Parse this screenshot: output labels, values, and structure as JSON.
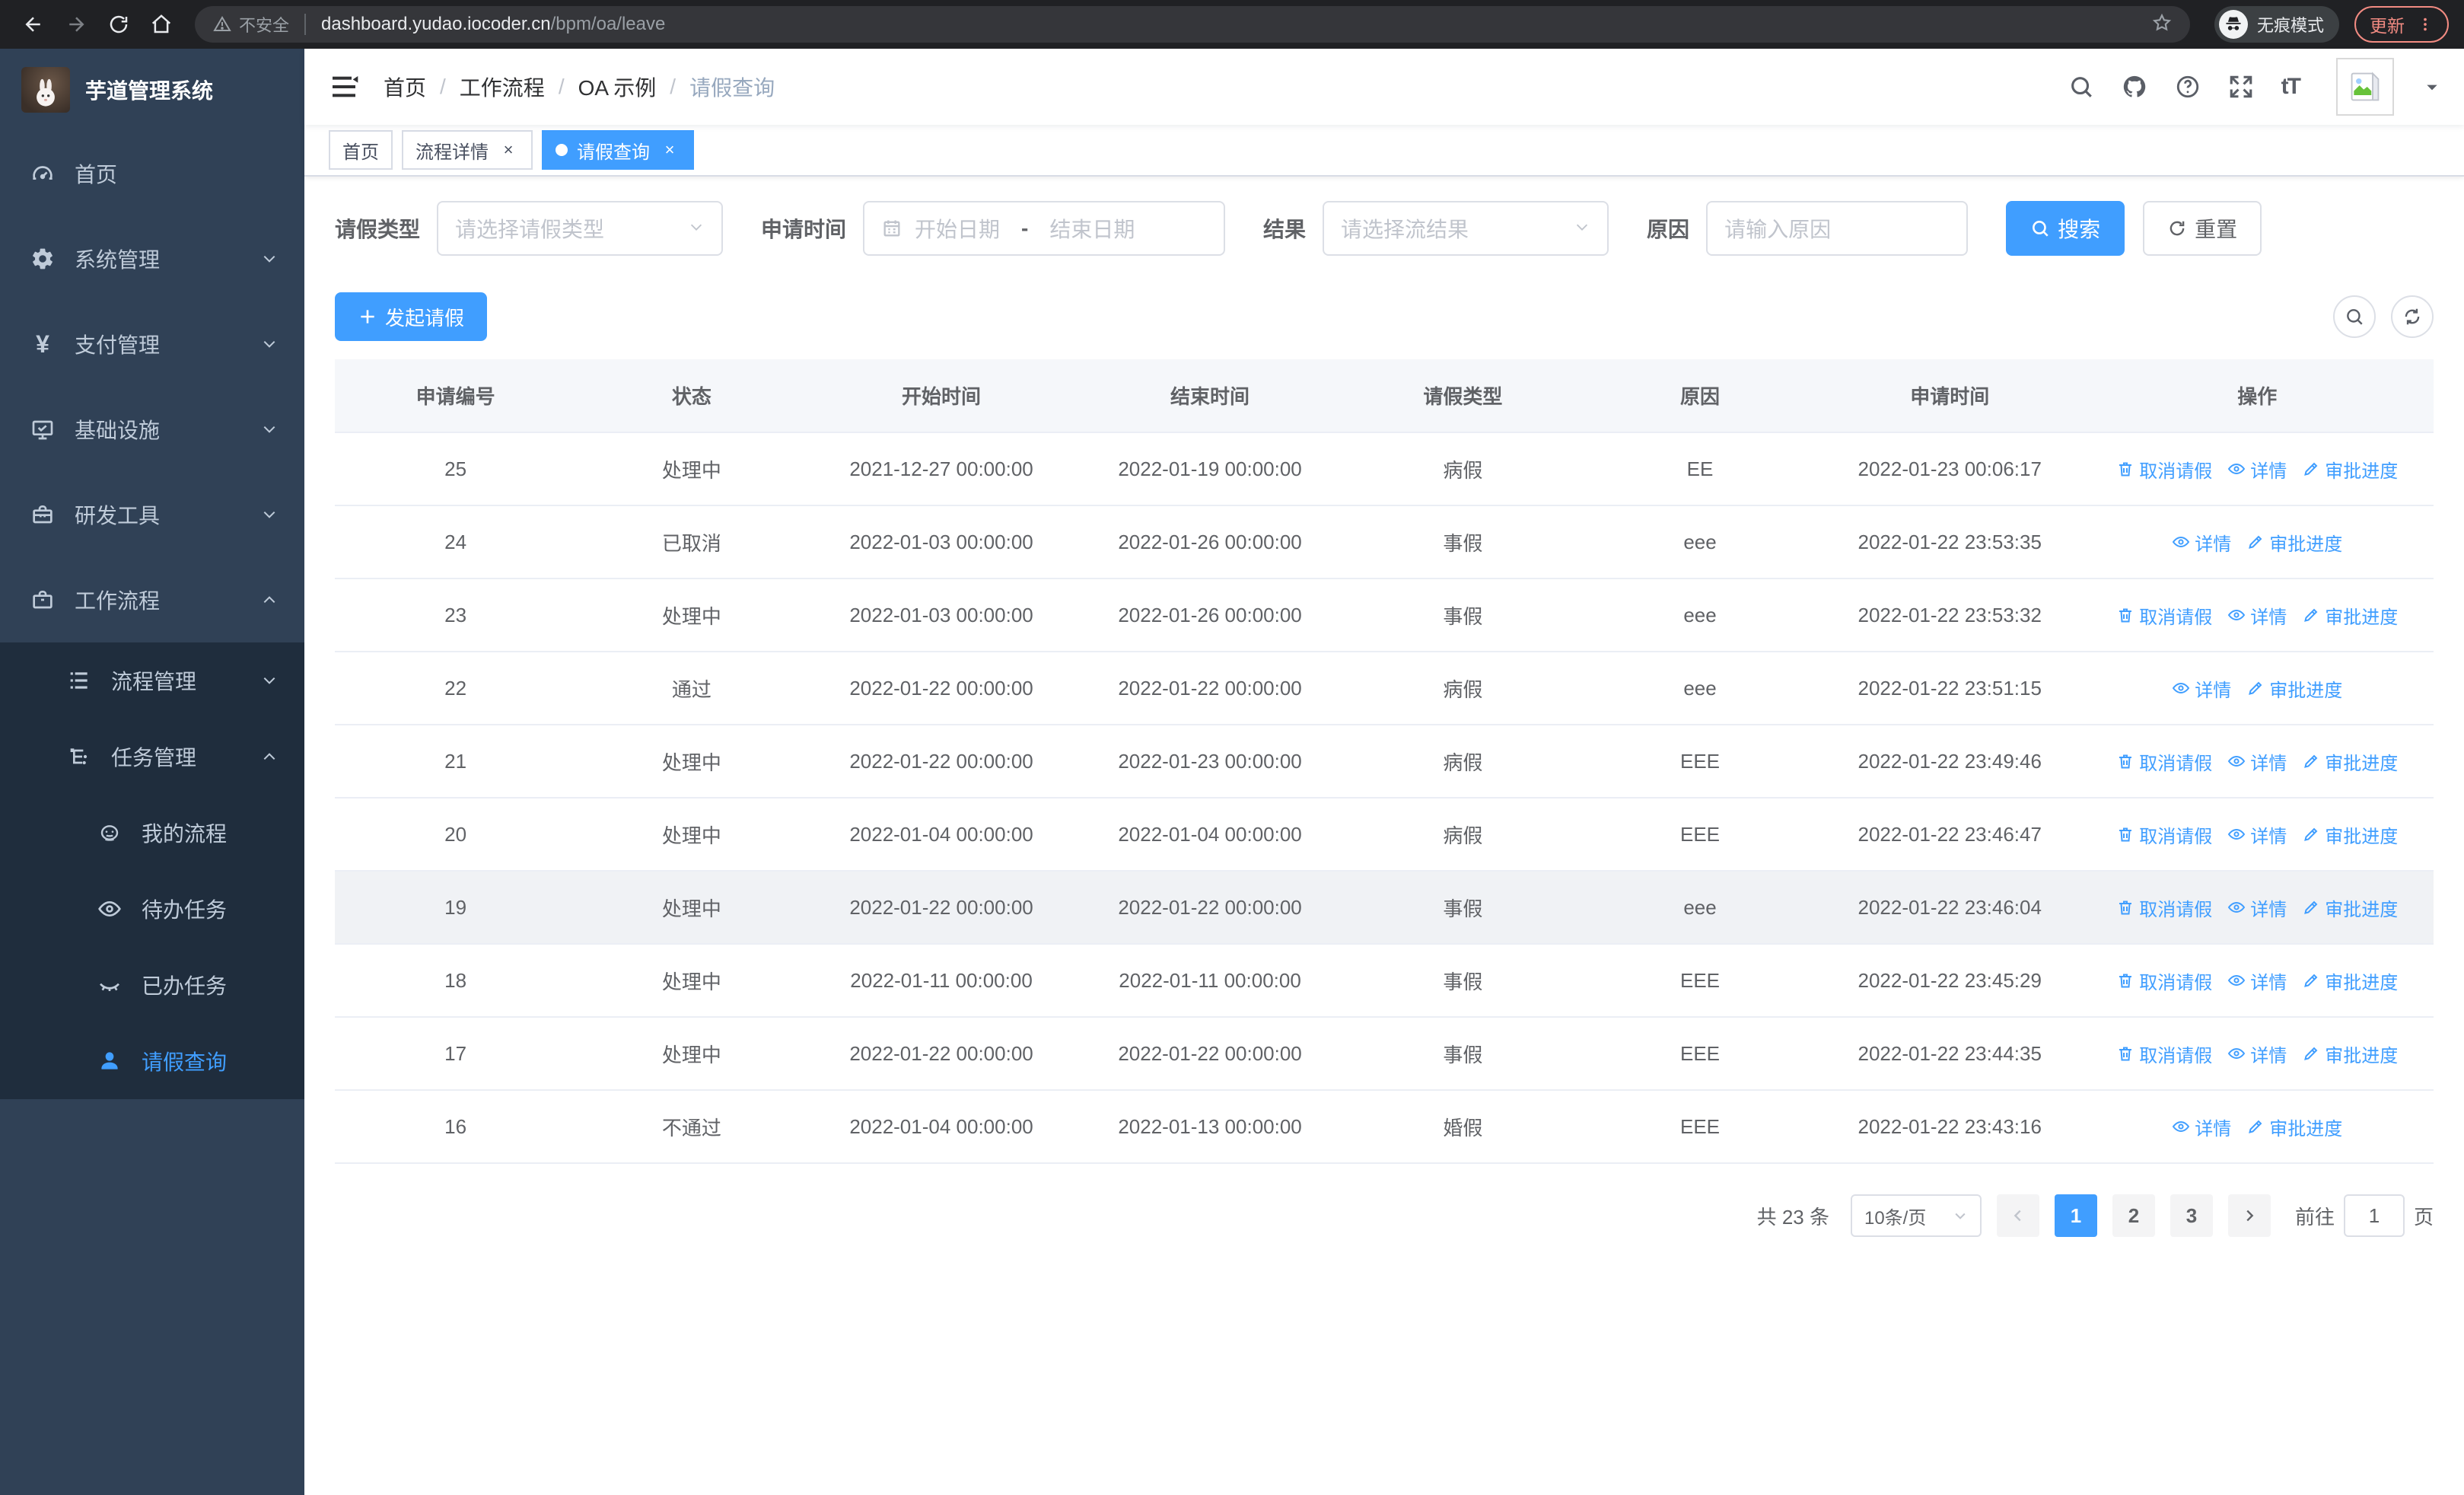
{
  "colors": {
    "accent": "#409EFF",
    "sidebar_bg": "#304156",
    "submenu_bg": "#1f2d3d",
    "update_badge": "#f28b82"
  },
  "browser": {
    "security_label": "不安全",
    "url_host": "dashboard.yudao.iocoder.cn",
    "url_path": "/bpm/oa/leave",
    "incognito_label": "无痕模式",
    "update_label": "更新"
  },
  "sidebar": {
    "title": "芋道管理系统",
    "items": [
      {
        "label": "首页",
        "icon": "gauge-icon",
        "level": 1
      },
      {
        "label": "系统管理",
        "icon": "gear-icon",
        "level": 1,
        "chevron": "down"
      },
      {
        "label": "支付管理",
        "icon": "yen-icon",
        "level": 1,
        "chevron": "down"
      },
      {
        "label": "基础设施",
        "icon": "monitor-icon",
        "level": 1,
        "chevron": "down"
      },
      {
        "label": "研发工具",
        "icon": "toolbox-icon",
        "level": 1,
        "chevron": "down"
      },
      {
        "label": "工作流程",
        "icon": "briefcase-icon",
        "level": 1,
        "chevron": "up"
      },
      {
        "label": "流程管理",
        "icon": "list-icon",
        "level": 2,
        "chevron": "down",
        "submenu": true
      },
      {
        "label": "任务管理",
        "icon": "flow-icon",
        "level": 2,
        "chevron": "up",
        "submenu": true
      },
      {
        "label": "我的流程",
        "icon": "robot-icon",
        "level": 3,
        "submenu": true
      },
      {
        "label": "待办任务",
        "icon": "eye-icon",
        "level": 3,
        "submenu": true
      },
      {
        "label": "已办任务",
        "icon": "eye-closed-icon",
        "level": 3,
        "submenu": true
      },
      {
        "label": "请假查询",
        "icon": "user-icon",
        "level": 3,
        "submenu": true,
        "active": true
      }
    ]
  },
  "navbar": {
    "breadcrumb": [
      "首页",
      "工作流程",
      "OA 示例",
      "请假查询"
    ]
  },
  "tags": [
    {
      "label": "首页",
      "closable": false,
      "active": false
    },
    {
      "label": "流程详情",
      "closable": true,
      "active": false
    },
    {
      "label": "请假查询",
      "closable": true,
      "active": true
    }
  ],
  "filters": {
    "leave_type_label": "请假类型",
    "leave_type_placeholder": "请选择请假类型",
    "apply_time_label": "申请时间",
    "start_placeholder": "开始日期",
    "range_separator": "-",
    "end_placeholder": "结束日期",
    "result_label": "结果",
    "result_placeholder": "请选择流结果",
    "reason_label": "原因",
    "reason_placeholder": "请输入原因",
    "search_label": "搜索",
    "reset_label": "重置"
  },
  "toolbar": {
    "create_label": "发起请假"
  },
  "table": {
    "columns": [
      "申请编号",
      "状态",
      "开始时间",
      "结束时间",
      "请假类型",
      "原因",
      "申请时间",
      "操作"
    ],
    "action_labels": {
      "cancel": "取消请假",
      "detail": "详情",
      "progress": "审批进度"
    },
    "rows": [
      {
        "id": "25",
        "status": "处理中",
        "start": "2021-12-27 00:00:00",
        "end": "2022-01-19 00:00:00",
        "type": "病假",
        "reason": "EE",
        "apply": "2022-01-23 00:06:17",
        "actions": [
          "cancel",
          "detail",
          "progress"
        ],
        "highlight": false
      },
      {
        "id": "24",
        "status": "已取消",
        "start": "2022-01-03 00:00:00",
        "end": "2022-01-26 00:00:00",
        "type": "事假",
        "reason": "eee",
        "apply": "2022-01-22 23:53:35",
        "actions": [
          "detail",
          "progress"
        ],
        "highlight": false
      },
      {
        "id": "23",
        "status": "处理中",
        "start": "2022-01-03 00:00:00",
        "end": "2022-01-26 00:00:00",
        "type": "事假",
        "reason": "eee",
        "apply": "2022-01-22 23:53:32",
        "actions": [
          "cancel",
          "detail",
          "progress"
        ],
        "highlight": false
      },
      {
        "id": "22",
        "status": "通过",
        "start": "2022-01-22 00:00:00",
        "end": "2022-01-22 00:00:00",
        "type": "病假",
        "reason": "eee",
        "apply": "2022-01-22 23:51:15",
        "actions": [
          "detail",
          "progress"
        ],
        "highlight": false
      },
      {
        "id": "21",
        "status": "处理中",
        "start": "2022-01-22 00:00:00",
        "end": "2022-01-23 00:00:00",
        "type": "病假",
        "reason": "EEE",
        "apply": "2022-01-22 23:49:46",
        "actions": [
          "cancel",
          "detail",
          "progress"
        ],
        "highlight": false
      },
      {
        "id": "20",
        "status": "处理中",
        "start": "2022-01-04 00:00:00",
        "end": "2022-01-04 00:00:00",
        "type": "病假",
        "reason": "EEE",
        "apply": "2022-01-22 23:46:47",
        "actions": [
          "cancel",
          "detail",
          "progress"
        ],
        "highlight": false
      },
      {
        "id": "19",
        "status": "处理中",
        "start": "2022-01-22 00:00:00",
        "end": "2022-01-22 00:00:00",
        "type": "事假",
        "reason": "eee",
        "apply": "2022-01-22 23:46:04",
        "actions": [
          "cancel",
          "detail",
          "progress"
        ],
        "highlight": true
      },
      {
        "id": "18",
        "status": "处理中",
        "start": "2022-01-11 00:00:00",
        "end": "2022-01-11 00:00:00",
        "type": "事假",
        "reason": "EEE",
        "apply": "2022-01-22 23:45:29",
        "actions": [
          "cancel",
          "detail",
          "progress"
        ],
        "highlight": false
      },
      {
        "id": "17",
        "status": "处理中",
        "start": "2022-01-22 00:00:00",
        "end": "2022-01-22 00:00:00",
        "type": "事假",
        "reason": "EEE",
        "apply": "2022-01-22 23:44:35",
        "actions": [
          "cancel",
          "detail",
          "progress"
        ],
        "highlight": false
      },
      {
        "id": "16",
        "status": "不通过",
        "start": "2022-01-04 00:00:00",
        "end": "2022-01-13 00:00:00",
        "type": "婚假",
        "reason": "EEE",
        "apply": "2022-01-22 23:43:16",
        "actions": [
          "detail",
          "progress"
        ],
        "highlight": false
      }
    ]
  },
  "pagination": {
    "total_text": "共 23 条",
    "page_size_text": "10条/页",
    "pages": [
      "1",
      "2",
      "3"
    ],
    "active_page": "1",
    "goto_label": "前往",
    "goto_value": "1",
    "page_unit": "页"
  }
}
